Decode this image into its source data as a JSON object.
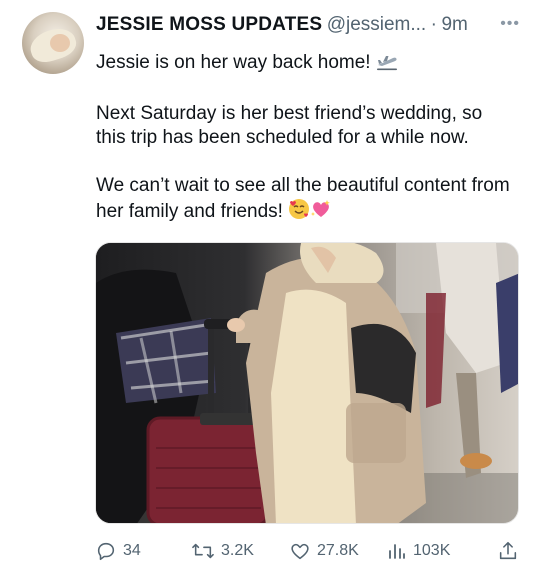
{
  "tweet": {
    "display_name": "JESSIE MOSS UPDATES",
    "handle": "@jessiem...",
    "separator": "·",
    "time": "9m",
    "more_icon": "more-horizontal-icon",
    "paragraphs": [
      "Jessie is on her way back home! ",
      "Next Saturday is her best friend’s wedding, so this trip has been scheduled for a while now.",
      "We can’t wait to see all the beautiful content from her family and friends! "
    ],
    "emoji": {
      "p1": "airplane-departure-emoji",
      "p3": [
        "smiling-face-with-hearts-emoji",
        "sparkling-heart-emoji"
      ]
    }
  },
  "actions": {
    "replies": "34",
    "retweets": "3.2K",
    "likes": "27.8K",
    "views": "103K"
  },
  "colors": {
    "text": "#0f1419",
    "muted": "#536471",
    "background": "#ffffff"
  }
}
